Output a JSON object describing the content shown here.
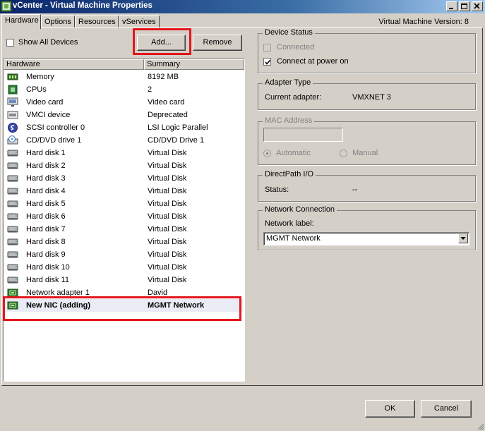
{
  "window": {
    "title": "vCenter - Virtual Machine Properties",
    "vm_version": "Virtual Machine Version: 8"
  },
  "tabs": [
    {
      "label": "Hardware"
    },
    {
      "label": "Options"
    },
    {
      "label": "Resources"
    },
    {
      "label": "vServices"
    }
  ],
  "toolbar": {
    "show_all_label": "Show All Devices",
    "show_all_checked": false,
    "add_label": "Add...",
    "remove_label": "Remove"
  },
  "hardware_table": {
    "columns": [
      "Hardware",
      "Summary"
    ],
    "rows": [
      {
        "name": "Memory",
        "summary": "8192 MB",
        "icon": "memory-icon"
      },
      {
        "name": "CPUs",
        "summary": "2",
        "icon": "cpu-icon"
      },
      {
        "name": "Video card",
        "summary": "Video card",
        "icon": "monitor-icon"
      },
      {
        "name": "VMCI device",
        "summary": "Deprecated",
        "icon": "device-icon"
      },
      {
        "name": "SCSI controller 0",
        "summary": "LSI Logic Parallel",
        "icon": "scsi-icon"
      },
      {
        "name": "CD/DVD drive 1",
        "summary": "CD/DVD Drive 1",
        "icon": "cd-drive-icon"
      },
      {
        "name": "Hard disk 1",
        "summary": "Virtual Disk",
        "icon": "hard-disk-icon"
      },
      {
        "name": "Hard disk 2",
        "summary": "Virtual Disk",
        "icon": "hard-disk-icon"
      },
      {
        "name": "Hard disk 3",
        "summary": "Virtual Disk",
        "icon": "hard-disk-icon"
      },
      {
        "name": "Hard disk 4",
        "summary": "Virtual Disk",
        "icon": "hard-disk-icon"
      },
      {
        "name": "Hard disk 5",
        "summary": "Virtual Disk",
        "icon": "hard-disk-icon"
      },
      {
        "name": "Hard disk 6",
        "summary": "Virtual Disk",
        "icon": "hard-disk-icon"
      },
      {
        "name": "Hard disk 7",
        "summary": "Virtual Disk",
        "icon": "hard-disk-icon"
      },
      {
        "name": "Hard disk 8",
        "summary": "Virtual Disk",
        "icon": "hard-disk-icon"
      },
      {
        "name": "Hard disk 9",
        "summary": "Virtual Disk",
        "icon": "hard-disk-icon"
      },
      {
        "name": "Hard disk 10",
        "summary": "Virtual Disk",
        "icon": "hard-disk-icon"
      },
      {
        "name": "Hard disk 11",
        "summary": "Virtual Disk",
        "icon": "hard-disk-icon"
      },
      {
        "name": "Network adapter 1",
        "summary": "David",
        "icon": "network-card-icon"
      },
      {
        "name": "New NIC (adding)",
        "summary": "MGMT Network",
        "icon": "network-card-icon",
        "selected": true
      }
    ]
  },
  "device_status": {
    "legend": "Device Status",
    "connected_label": "Connected",
    "connected_checked": false,
    "connect_power_label": "Connect at power on",
    "connect_power_checked": true
  },
  "adapter_type": {
    "legend": "Adapter Type",
    "label": "Current adapter:",
    "value": "VMXNET 3"
  },
  "mac_address": {
    "legend": "MAC Address",
    "value": "",
    "automatic_label": "Automatic",
    "manual_label": "Manual"
  },
  "directpath": {
    "legend": "DirectPath I/O",
    "label": "Status:",
    "value": "--"
  },
  "network_connection": {
    "legend": "Network Connection",
    "label": "Network label:",
    "selected": "MGMT Network"
  },
  "footer": {
    "ok_label": "OK",
    "cancel_label": "Cancel"
  }
}
